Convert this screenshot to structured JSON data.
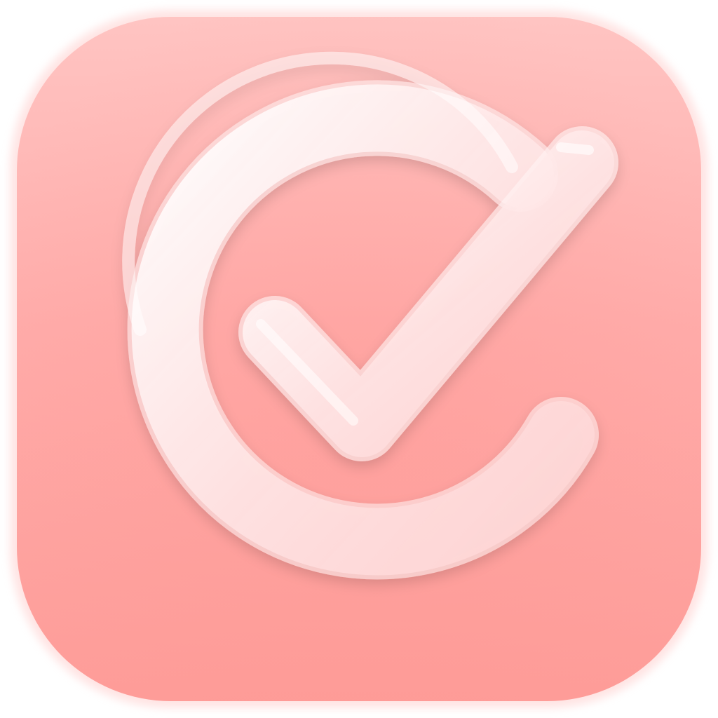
{
  "icon": {
    "semantic": "checkmark-circle-icon",
    "colors": {
      "tile_top": "#ffc4c2",
      "tile_mid": "#ffacaa",
      "tile_bottom": "#fe9c98",
      "tile_edge_glow": "#ffd9d8",
      "glyph_fill": "#ffe4e4",
      "glyph_highlight": "#ffffff",
      "glyph_edge": "#fff3f3"
    }
  }
}
